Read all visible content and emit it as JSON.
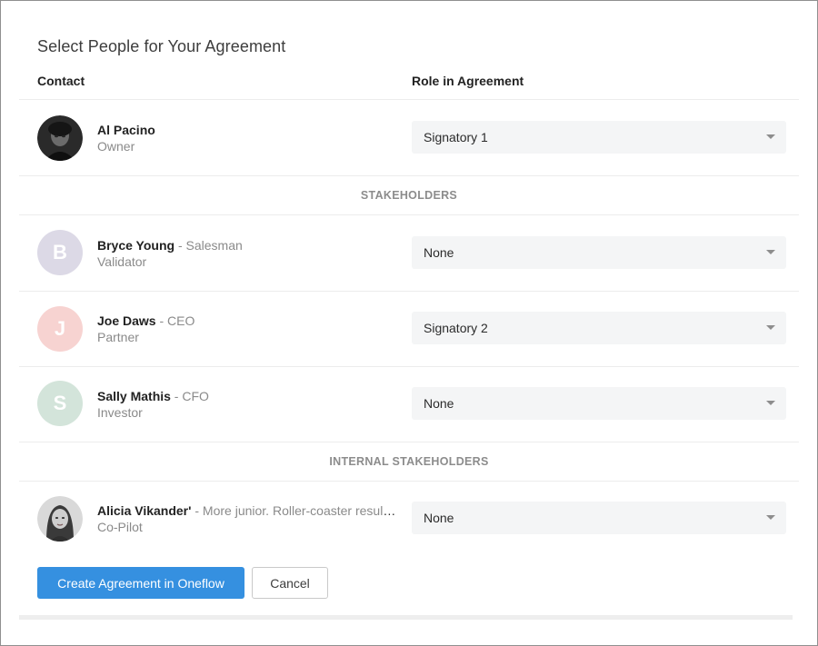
{
  "dialog": {
    "title": "Select People for Your Agreement",
    "columns": {
      "contact": "Contact",
      "role": "Role in Agreement"
    }
  },
  "owner": {
    "name": "Al Pacino",
    "subtitle": "Owner",
    "role": "Signatory 1"
  },
  "sections": {
    "stakeholders": "STAKEHOLDERS",
    "internal": "INTERNAL STAKEHOLDERS"
  },
  "stakeholders": [
    {
      "initial": "B",
      "name": "Bryce Young",
      "separator": " - ",
      "title": "Salesman",
      "subtitle": "Validator",
      "role": "None",
      "color": "#dcd9e6"
    },
    {
      "initial": "J",
      "name": "Joe Daws",
      "separator": " - ",
      "title": "CEO",
      "subtitle": "Partner",
      "role": "Signatory 2",
      "color": "#f7d3d1"
    },
    {
      "initial": "S",
      "name": "Sally Mathis",
      "separator": " - ",
      "title": "CFO",
      "subtitle": "Investor",
      "role": "None",
      "color": "#d3e4da"
    }
  ],
  "internal": [
    {
      "name": "Alicia Vikander'",
      "separator": " - ",
      "title": "More junior. Roller-coaster results. Lorem ipsum",
      "subtitle": "Co-Pilot",
      "role": "None"
    }
  ],
  "actions": {
    "create": "Create Agreement in Oneflow",
    "cancel": "Cancel"
  },
  "colors": {
    "primary": "#3590e0",
    "select_bg": "#f4f5f6",
    "muted_text": "#8a8a8a"
  }
}
